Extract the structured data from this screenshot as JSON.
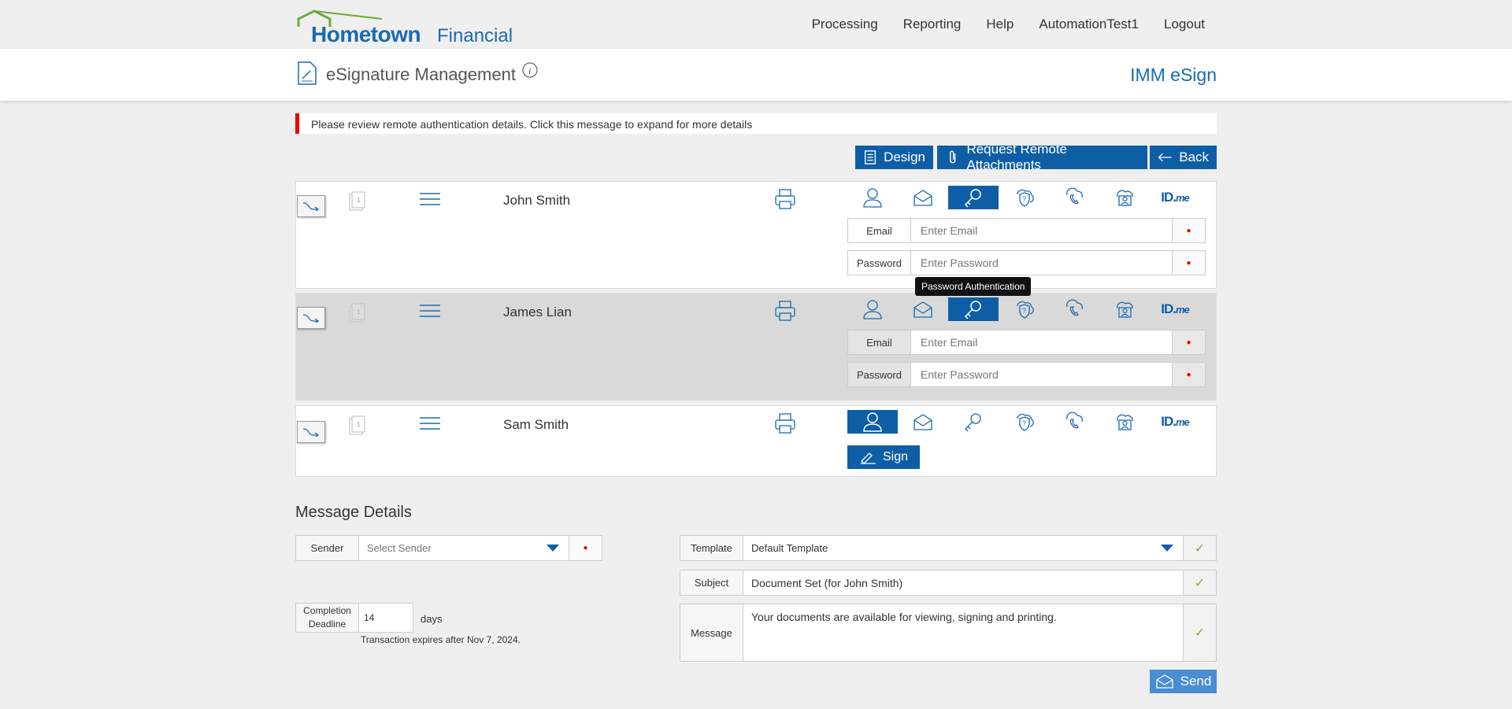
{
  "header": {
    "logo_main": "Hometown",
    "logo_sub": "Financial",
    "nav": [
      "Processing",
      "Reporting",
      "Help",
      "AutomationTest1",
      "Logout"
    ]
  },
  "titlebar": {
    "title": "eSignature Management",
    "product": "IMM eSign"
  },
  "alert": {
    "text": "Please review remote authentication details. Click this message to expand for more details",
    "color": "#e00000"
  },
  "actions": {
    "design": "Design",
    "attachments": "Request Remote Attachments",
    "back": "Back"
  },
  "signers": [
    {
      "name": "John Smith",
      "email_label": "Email",
      "email_placeholder": "Enter Email",
      "password_label": "Password",
      "password_placeholder": "Enter Password",
      "active_auth": "password-authentication"
    },
    {
      "name": "James Lian",
      "email_label": "Email",
      "email_placeholder": "Enter Email",
      "password_label": "Password",
      "password_placeholder": "Enter Password",
      "active_auth": "password-authentication"
    },
    {
      "name": "Sam Smith",
      "sign_label": "Sign",
      "active_auth": "in-person"
    }
  ],
  "auth_icons": [
    "person-icon",
    "email-envelope-icon",
    "key-icon",
    "shield-question-icon",
    "phone-icon",
    "cloud-id-icon",
    "idme-icon"
  ],
  "idme": {
    "main": "ID.",
    "sub": "me"
  },
  "tooltip": "Password Authentication",
  "message_details": {
    "title": "Message Details",
    "sender_label": "Sender",
    "sender_placeholder": "Select Sender",
    "deadline_label": "Completion Deadline",
    "deadline_value": "14",
    "days": "days",
    "expires": "Transaction expires after Nov 7, 2024.",
    "template_label": "Template",
    "template_value": "Default Template",
    "subject_label": "Subject",
    "subject_value": "Document Set (for John Smith)",
    "message_label": "Message",
    "message_value": "Your documents are available for viewing, signing and printing.",
    "send": "Send"
  },
  "colors": {
    "brand_blue": "#0e5ea6",
    "logo_green": "#6aab3b",
    "check_green": "#7aa94c"
  }
}
